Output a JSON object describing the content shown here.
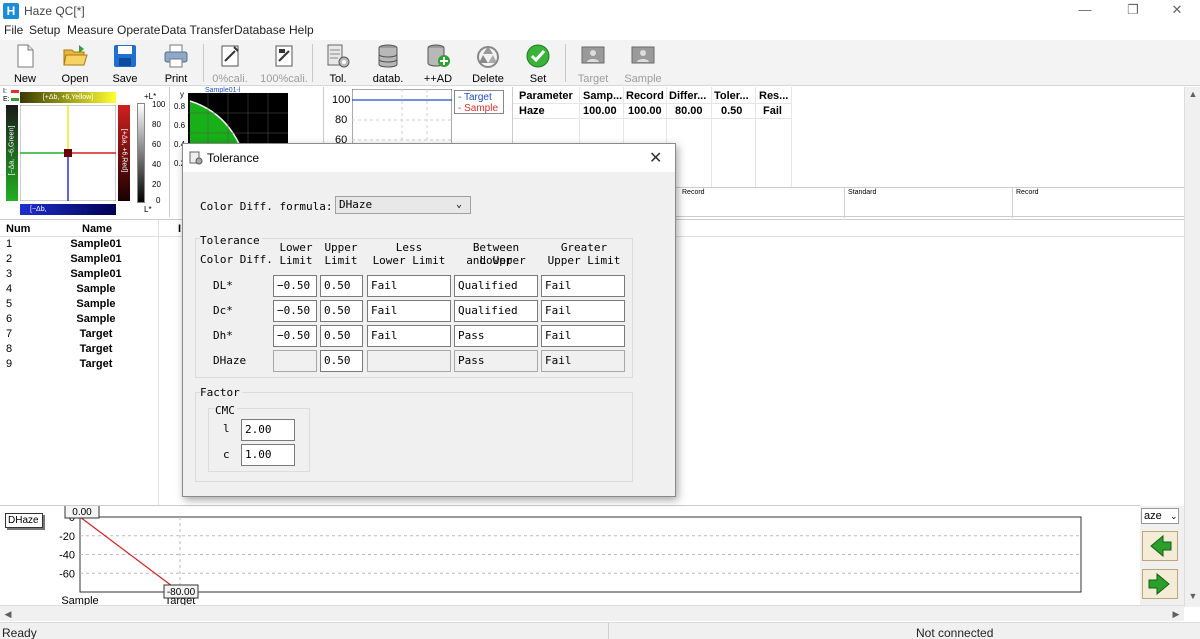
{
  "window": {
    "title": "Haze QC[*]",
    "icon_letter": "H",
    "controls": [
      "—",
      "❐",
      "✕"
    ]
  },
  "menu": [
    "File",
    "Setup",
    "Measure Operate",
    "Data Transfer",
    "Database",
    "Help"
  ],
  "toolbar": {
    "items": [
      {
        "label": "New",
        "icon": "new-file-icon",
        "enabled": true
      },
      {
        "label": "Open",
        "icon": "open-folder-icon",
        "enabled": true
      },
      {
        "label": "Save",
        "icon": "save-disk-icon",
        "enabled": true
      },
      {
        "label": "Print",
        "icon": "printer-icon",
        "enabled": true
      },
      {
        "label": "0%cali.",
        "icon": "zero-calibration-icon",
        "enabled": false
      },
      {
        "label": "100%cali.",
        "icon": "full-calibration-icon",
        "enabled": false
      },
      {
        "label": "Tol.",
        "icon": "tolerance-icon",
        "enabled": true
      },
      {
        "label": "datab.",
        "icon": "database-icon",
        "enabled": true
      },
      {
        "label": "++AD",
        "icon": "add-database-icon",
        "enabled": true
      },
      {
        "label": "Delete",
        "icon": "recycle-icon",
        "enabled": true
      },
      {
        "label": "Set",
        "icon": "check-icon",
        "enabled": true
      },
      {
        "label": "Target",
        "icon": "target-person-icon",
        "enabled": false
      },
      {
        "label": "Sample",
        "icon": "sample-person-icon",
        "enabled": false
      }
    ]
  },
  "color_plot": {
    "top_label": "[+Δb, +6,Yellow]",
    "bottom_label": "[−Δb,",
    "left_label": "[−Δa, −6,Green]",
    "right_label": "[+Δa, +6,Red]",
    "legend_i": "I:",
    "legend_e": "E:"
  },
  "lightness_scale": {
    "top": "+L*",
    "bottom": "L*",
    "ticks": [
      "100",
      "80",
      "60",
      "40",
      "20",
      "0"
    ]
  },
  "spectrum_plot": {
    "title": "Sample01-l",
    "y_axis_label": "y",
    "y_ticks": [
      "0.8",
      "0.6",
      "0.4",
      "0.2"
    ]
  },
  "trend_plot": {
    "y_ticks": [
      "100",
      "80",
      "60"
    ],
    "legend": [
      {
        "name": "Target",
        "color": "#1f4fbf"
      },
      {
        "name": "Sample",
        "color": "#e03030"
      }
    ]
  },
  "result_table": {
    "headers": [
      "Parameter",
      "Samp...",
      "Record",
      "Differ...",
      "Toler...",
      "Res..."
    ],
    "rows": [
      [
        "Haze",
        "100.00",
        "100.00",
        "80.00",
        "0.50",
        "Fail"
      ]
    ]
  },
  "compare_table": {
    "headers": [
      "Record",
      "Standard",
      "Record"
    ]
  },
  "sample_list": {
    "headers": [
      "Num",
      "Name",
      "I"
    ],
    "rows": [
      [
        "1",
        "Sample01"
      ],
      [
        "2",
        "Sample01"
      ],
      [
        "3",
        "Sample01"
      ],
      [
        "4",
        "Sample"
      ],
      [
        "5",
        "Sample"
      ],
      [
        "6",
        "Sample"
      ],
      [
        "7",
        "Target"
      ],
      [
        "8",
        "Target"
      ],
      [
        "9",
        "Target"
      ]
    ]
  },
  "dialog": {
    "title": "Tolerance",
    "formula_label": "Color Diff. formula:",
    "formula_value": "DHaze",
    "tolerance_group": "Tolerance",
    "row_header": "Color Diff.",
    "col_headers": [
      [
        "Lower",
        "Limit"
      ],
      [
        "Upper",
        "Limit"
      ],
      [
        "Less",
        "Lower Limit"
      ],
      [
        "Between Lower",
        "and Upper"
      ],
      [
        "Greater",
        "Upper Limit"
      ]
    ],
    "rows": [
      {
        "name": "DL*",
        "lower": "−0.50",
        "upper": "0.50",
        "less": "Fail",
        "between": "Qualified",
        "greater": "Fail"
      },
      {
        "name": "Dc*",
        "lower": "−0.50",
        "upper": "0.50",
        "less": "Fail",
        "between": "Qualified",
        "greater": "Fail"
      },
      {
        "name": "Dh*",
        "lower": "−0.50",
        "upper": "0.50",
        "less": "Fail",
        "between": "Pass",
        "greater": "Fail"
      },
      {
        "name": "DHaze",
        "lower": "",
        "upper": "0.50",
        "less": "",
        "between": "Pass",
        "greater": "Fail"
      }
    ],
    "factor_group": "Factor",
    "cmc_label": "CMC",
    "factor_l_label": "l",
    "factor_l_value": "2.00",
    "factor_c_label": "c",
    "factor_c_value": "1.00"
  },
  "bottom_chart": {
    "series_label": "DHaze",
    "start_value_label": "0.00",
    "end_value_label": "-80.00",
    "selector_value": "aze",
    "chart_data": {
      "type": "line",
      "categories": [
        "Sample",
        "Target"
      ],
      "values": [
        0,
        -80
      ],
      "y_ticks": [
        0,
        -20,
        -40,
        -60
      ],
      "ylim": [
        -80,
        0
      ],
      "grid": true,
      "color": "#cc2222"
    }
  },
  "status": {
    "left": "Ready",
    "right": "Not connected"
  }
}
